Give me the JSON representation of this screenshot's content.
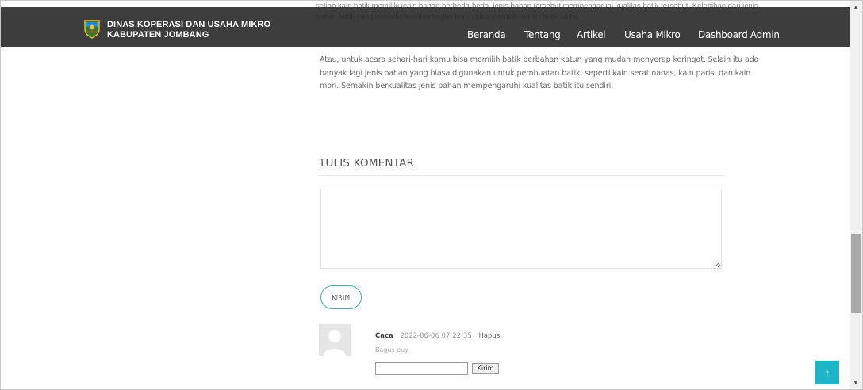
{
  "header": {
    "brand_line1": "DINAS KOPERASI DAN USAHA MIKRO",
    "brand_line2": "KABUPATEN JOMBANG",
    "nav": [
      "Beranda",
      "Tentang",
      "Artikel",
      "Usaha Mikro",
      "Dashboard Admin"
    ]
  },
  "article": {
    "hidden_text": "setiap kain batik memiliki jenis bahan berbeda-beda, jenis bahan tersebut mempengaruhi kualitas batik tersebut. Kelebihan dari jenis bahan batik yang memiliki kualitas bagus kamu bisa memilih bahan batik sutra.",
    "paragraph": "Atau, untuk acara sehari-hari kamu bisa memilih batik berbahan katun yang mudah menyerap keringat. Selain itu ada banyak lagi jenis bahan yang biasa digunakan untuk pembuatan batik, seperti kain serat nanas, kain paris, dan kain mori. Semakin berkualitas jenis bahan mempengaruhi kualitas batik itu sendiri."
  },
  "comment_form": {
    "title": "TULIS KOMENTAR",
    "textarea_value": "",
    "submit_label": "KIRIM"
  },
  "comments": [
    {
      "author": "Caca",
      "date": "2022-06-06 07:22:35",
      "delete_label": "Hapus",
      "text": "Bagus euy",
      "reply_value": "",
      "reply_button": "Kirim"
    }
  ],
  "scroll_to_top_icon": "arrow-up-icon",
  "colors": {
    "header_bg": "#282828",
    "accent": "#3db8a0",
    "to_top_bg": "#1fb5c8"
  }
}
